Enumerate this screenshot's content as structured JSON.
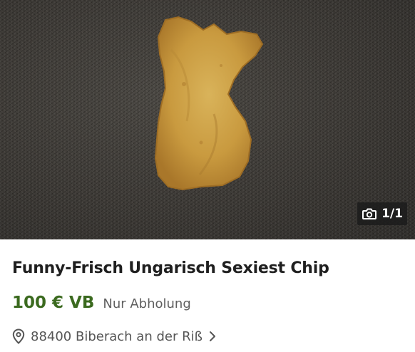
{
  "listing": {
    "image_counter": "1/1",
    "title": "Funny-Frisch Ungarisch Sexiest Chip",
    "price": "100 € VB",
    "delivery": "Nur Abholung",
    "location": "88400 Biberach an der Riß"
  },
  "icons": {
    "camera": "camera-icon",
    "location": "map-pin-icon",
    "chevron": "chevron-right-icon"
  },
  "colors": {
    "price": "#3b6a1f",
    "title": "#1f1f1f",
    "secondary_text": "#5f5f5f",
    "counter_background": "#1c1c1c"
  }
}
